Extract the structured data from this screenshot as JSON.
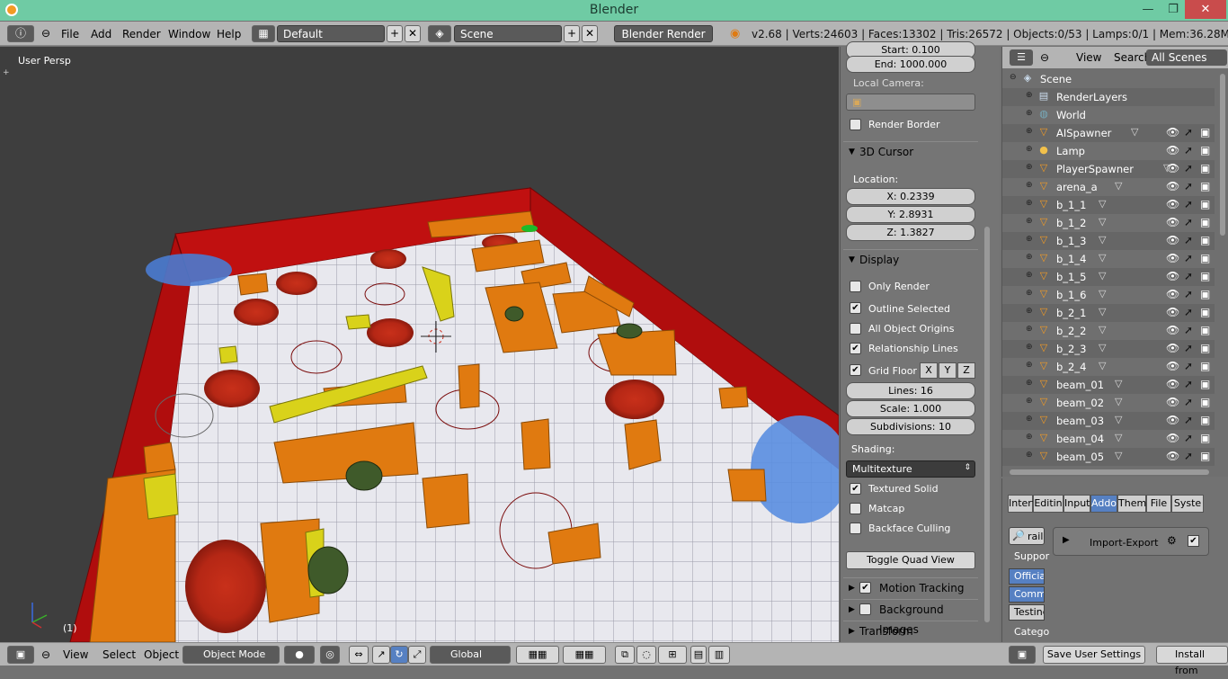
{
  "window": {
    "title": "Blender",
    "minimize": "—",
    "maximize": "❐",
    "close": "✕"
  },
  "info_header": {
    "menus": [
      "File",
      "Add",
      "Render",
      "Window",
      "Help"
    ],
    "layout": "Default",
    "scene": "Scene",
    "engine": "Blender Render",
    "stats": "v2.68 | Verts:24603 | Faces:13302 | Tris:26572 | Objects:0/53 | Lamps:0/1 | Mem:36.28M (208.67M)"
  },
  "viewport": {
    "label": "User Persp",
    "frame": "(1)"
  },
  "properties": {
    "start": "Start: 0.100",
    "end": "End: 1000.000",
    "local_camera_label": "Local Camera:",
    "render_border": "Render Border",
    "cursor_panel": "3D Cursor",
    "location_label": "Location:",
    "x": "X: 0.2339",
    "y": "Y: 2.8931",
    "z": "Z: 1.3827",
    "display_panel": "Display",
    "only_render": "Only Render",
    "outline_selected": "Outline Selected",
    "all_object_origins": "All Object Origins",
    "relationship_lines": "Relationship Lines",
    "grid_floor": "Grid Floor",
    "axis_x": "X",
    "axis_y": "Y",
    "axis_z": "Z",
    "lines": "Lines: 16",
    "scale": "Scale: 1.000",
    "subdivisions": "Subdivisions: 10",
    "shading_label": "Shading:",
    "shading_value": "Multitexture",
    "textured_solid": "Textured Solid",
    "matcap": "Matcap",
    "backface_culling": "Backface Culling",
    "toggle_quad": "Toggle Quad View",
    "motion_tracking": "Motion Tracking",
    "background_images": "Background Images",
    "transform_orientations": "Transform Orientations"
  },
  "outliner": {
    "view": "View",
    "search": "Search",
    "filter": "All Scenes",
    "items": [
      {
        "name": "Scene"
      },
      {
        "name": "RenderLayers"
      },
      {
        "name": "World"
      },
      {
        "name": "AISpawner"
      },
      {
        "name": "Lamp"
      },
      {
        "name": "PlayerSpawner"
      },
      {
        "name": "arena_a"
      },
      {
        "name": "b_1_1"
      },
      {
        "name": "b_1_2"
      },
      {
        "name": "b_1_3"
      },
      {
        "name": "b_1_4"
      },
      {
        "name": "b_1_5"
      },
      {
        "name": "b_1_6"
      },
      {
        "name": "b_2_1"
      },
      {
        "name": "b_2_2"
      },
      {
        "name": "b_2_3"
      },
      {
        "name": "b_2_4"
      },
      {
        "name": "beam_01"
      },
      {
        "name": "beam_02"
      },
      {
        "name": "beam_03"
      },
      {
        "name": "beam_04"
      },
      {
        "name": "beam_05"
      }
    ]
  },
  "prefs": {
    "tabs": [
      "Interf",
      "Editin",
      "Input",
      "Addo",
      "Them",
      "File",
      "Syste"
    ],
    "search_value": "rail",
    "support_label": "Suppor",
    "support_items": [
      "Official",
      "Comm",
      "Testing"
    ],
    "category_label": "Catego",
    "addon_name": "Import-Export",
    "save_settings": "Save User Settings",
    "install": "Install from"
  },
  "bottom_header": {
    "menus": [
      "View",
      "Select",
      "Object"
    ],
    "mode": "Object Mode",
    "orientation": "Global"
  },
  "colors": {
    "accent": "#5680c2",
    "titlebar": "#6fcba4",
    "close": "#c94c4c",
    "wall": "#b00d0d",
    "block": "#e07a10"
  }
}
